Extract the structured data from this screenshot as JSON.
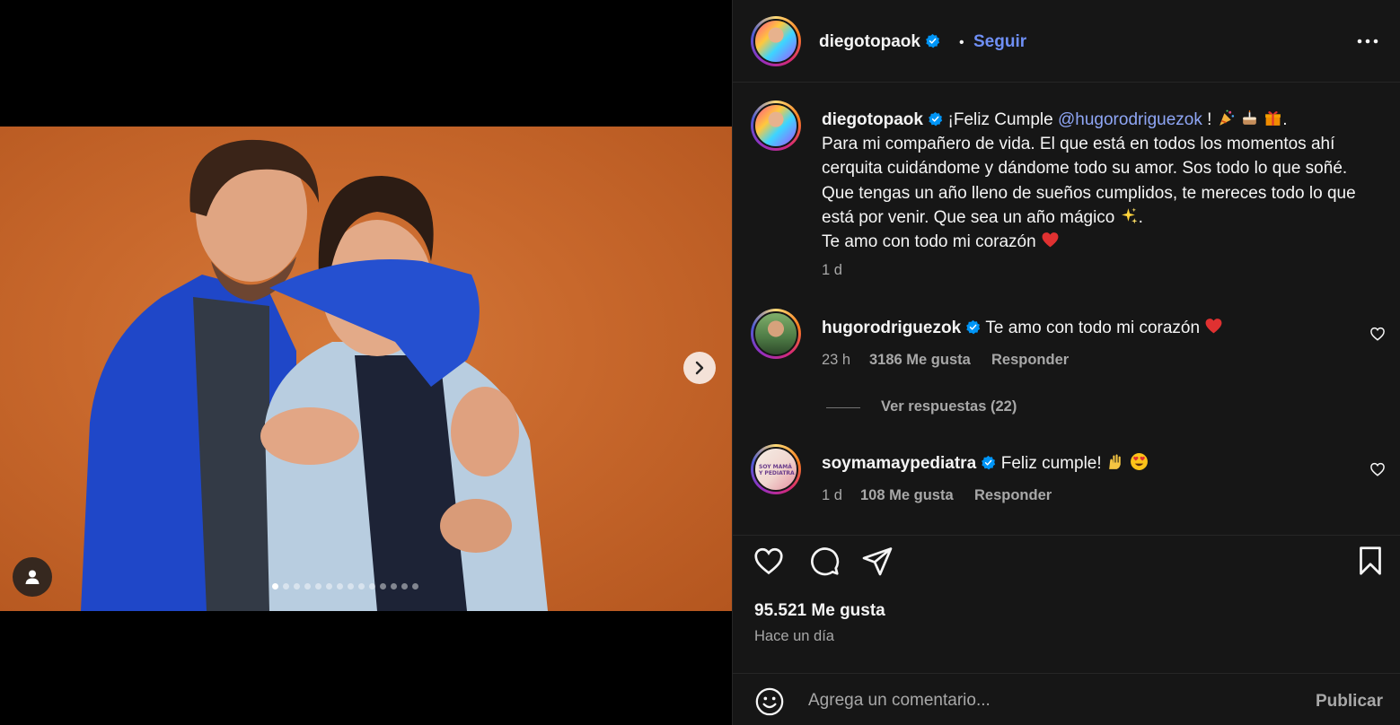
{
  "media": {
    "carousel_total": 14,
    "carousel_current": 1
  },
  "post": {
    "author": "diegotopaok",
    "follow_label": "Seguir",
    "follow_separator": "•",
    "caption_prefix": "¡Feliz Cumple ",
    "caption_mention": "@hugorodriguezok",
    "caption_after_mention": " ! ",
    "caption_line1_end": ".",
    "caption_body": "Para mi compañero de vida. El que está en todos los momentos ahí cerquita cuidándome y dándome todo su amor. Sos todo lo que soñé. Que tengas un año lleno de sueños cumplidos, te mereces todo lo que está por venir. Que sea un año mágico ",
    "caption_body_end": ".",
    "caption_last": "Te amo con todo mi corazón ",
    "caption_age": "1 d",
    "likes": "95.521 Me gusta",
    "time_ago": "Hace un día"
  },
  "comments": [
    {
      "user": "hugorodriguezok",
      "text": "Te amo con todo mi corazón ",
      "age": "23 h",
      "likes": "3186 Me gusta",
      "reply_label": "Responder",
      "view_replies": "Ver respuestas (22)"
    },
    {
      "user": "soymamaypediatra",
      "text": "Feliz cumple! ",
      "age": "1 d",
      "likes": "108 Me gusta",
      "reply_label": "Responder",
      "avatar_text": "SOY MAMÁ Y PEDIATRA"
    }
  ],
  "composer": {
    "placeholder": "Agrega un comentario...",
    "publish_label": "Publicar"
  },
  "colors": {
    "accent_link": "#6f8ff5",
    "mention": "#8fa6f5",
    "verified": "#0095f6",
    "panel_bg": "#161616"
  },
  "icons": [
    "chevron-right-icon",
    "user-tag-icon",
    "verified-icon",
    "more-icon",
    "heart-icon",
    "comment-icon",
    "share-icon",
    "bookmark-icon",
    "emoji-icon"
  ]
}
